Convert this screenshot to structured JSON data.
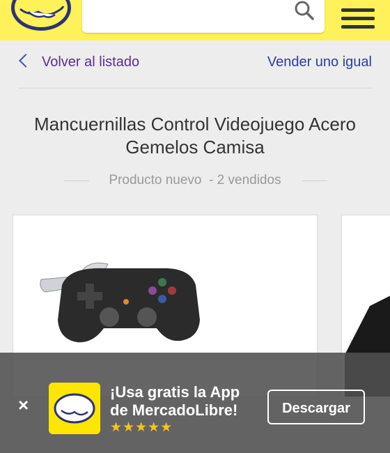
{
  "header": {
    "logo_icon": "mercadolibre-handshake-logo",
    "search_icon": "search-icon",
    "menu_icon": "hamburger-menu-icon",
    "brand_color": "#fff159"
  },
  "nav": {
    "back_label": "Volver al listado",
    "sell_label": "Vender uno igual"
  },
  "product": {
    "title_line1": "Mancuernillas Control Videojuego Acero",
    "title_line2": "Gemelos Camisa",
    "condition": "Producto nuevo",
    "sold": "- 2 vendidos"
  },
  "gallery": {
    "image_subject": "gamepad-cufflink-photo"
  },
  "app_banner": {
    "close_label": "×",
    "promo_line1": "¡Usa gratis la App",
    "promo_line2": "de MercadoLibre!",
    "rating_stars": "★★★★★",
    "rating": 4.5,
    "download_label": "Descargar"
  }
}
